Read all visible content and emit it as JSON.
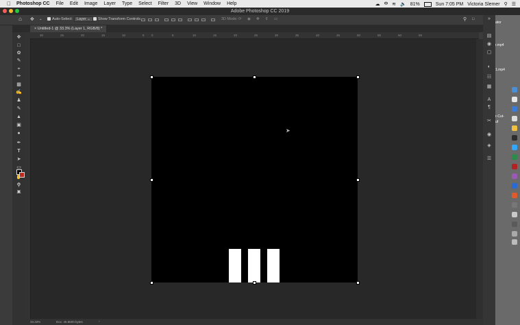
{
  "menubar": {
    "app_name": "Photoshop CC",
    "items": [
      "File",
      "Edit",
      "Image",
      "Layer",
      "Type",
      "Select",
      "Filter",
      "3D",
      "View",
      "Window",
      "Help"
    ],
    "battery": "81%",
    "clock": "Sun 7:05 PM",
    "user": "Victoria Slemer"
  },
  "window": {
    "title": "Adobe Photoshop CC 2019"
  },
  "options": {
    "auto_select_label": "Auto-Select:",
    "auto_select_value": "Layer",
    "show_transform_label": "Show Transform Controls",
    "mode_3d_label": "3D Mode:"
  },
  "document": {
    "tab_label": "Untitled-1 @ 33.3% (Layer 1, RGB/8) *"
  },
  "ruler": {
    "h_ticks": [
      "30",
      "25",
      "20",
      "15",
      "10",
      "5",
      "0",
      "5",
      "10",
      "15",
      "20",
      "25",
      "30",
      "35",
      "40",
      "45",
      "50",
      "55",
      "60",
      "65"
    ]
  },
  "status": {
    "zoom": "33.33%",
    "doc_info": "Doc: 45.8M/0 bytes"
  },
  "desktop": {
    "labels": [
      "ator",
      "r.mp4",
      "1.mp4",
      "r-Cut-",
      "uf"
    ]
  },
  "colors": {
    "foreground": "#000000",
    "background": "#c0281c",
    "canvas": "#000000",
    "shape": "#ffffff"
  }
}
